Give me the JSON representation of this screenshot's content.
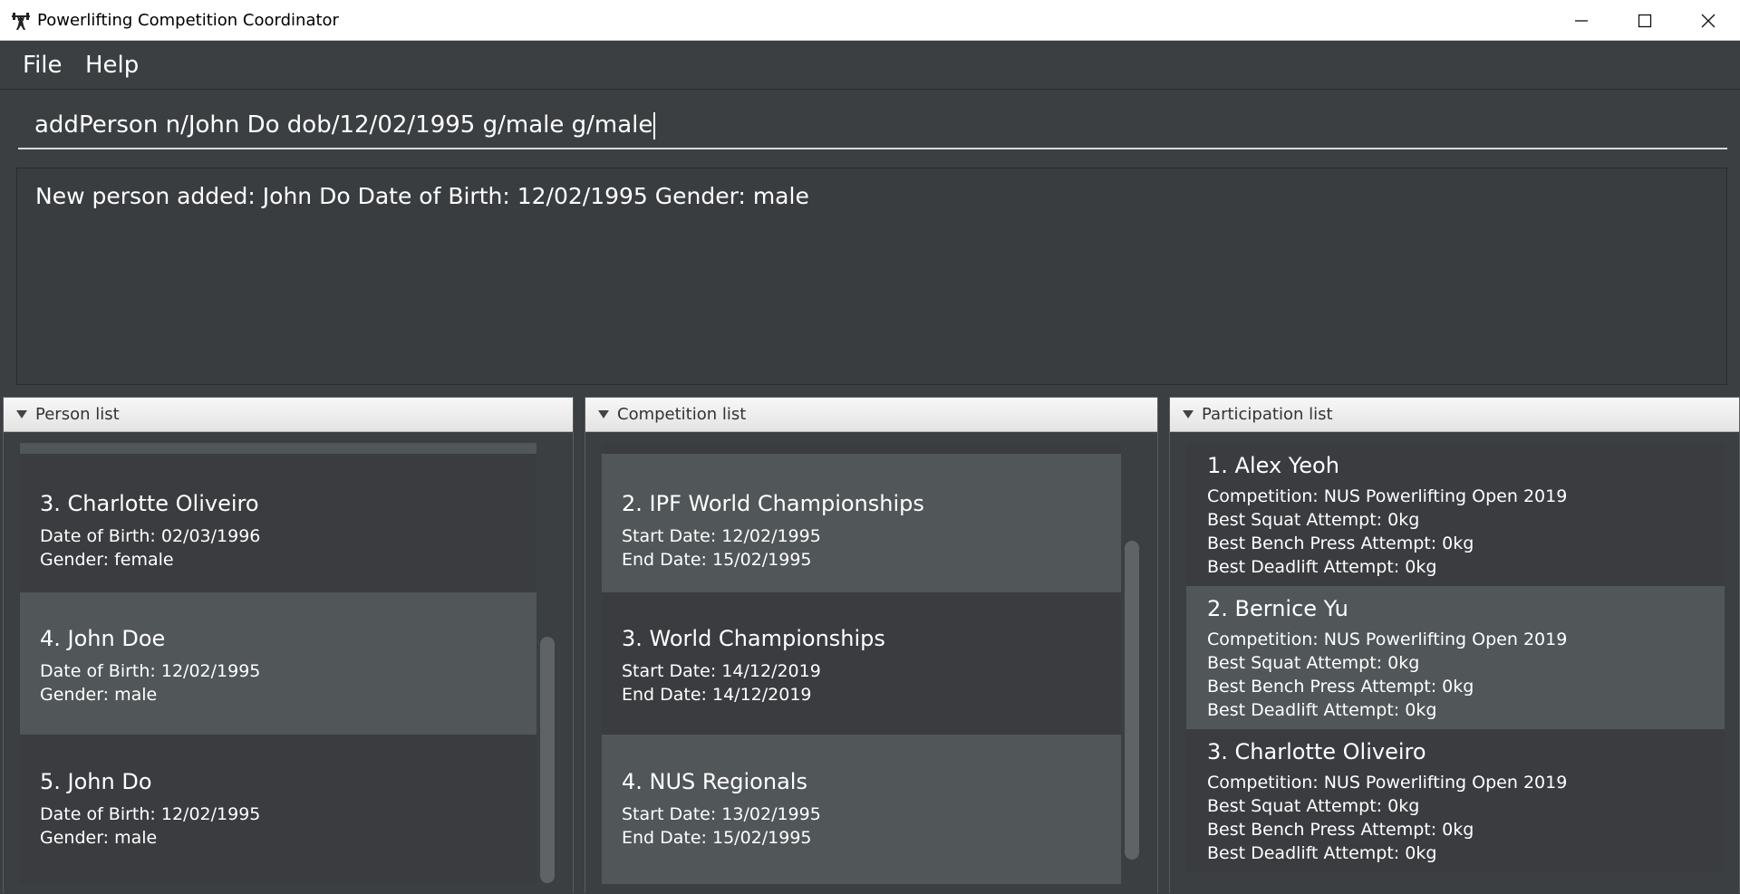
{
  "window": {
    "title": "Powerlifting Competition Coordinator"
  },
  "menu": {
    "file": "File",
    "help": "Help"
  },
  "command": {
    "value": "addPerson n/John Do dob/12/02/1995 g/male g/male"
  },
  "result": {
    "text": "New person added: John Do Date of Birth: 12/02/1995 Gender: male"
  },
  "person_panel": {
    "title": "Person list",
    "items": [
      {
        "name": "3.  Charlotte Oliveiro",
        "dob": "Date of Birth: 02/03/1996",
        "gender": "Gender: female"
      },
      {
        "name": "4.  John Doe",
        "dob": "Date of Birth: 12/02/1995",
        "gender": "Gender: male"
      },
      {
        "name": "5.  John Do",
        "dob": "Date of Birth: 12/02/1995",
        "gender": "Gender: male"
      }
    ]
  },
  "competition_panel": {
    "title": "Competition list",
    "items": [
      {
        "name": "2.  IPF World Championships",
        "start": "Start Date: 12/02/1995",
        "end": "End Date: 15/02/1995"
      },
      {
        "name": "3.  World Championships",
        "start": "Start Date: 14/12/2019",
        "end": "End Date: 14/12/2019"
      },
      {
        "name": "4.  NUS Regionals",
        "start": "Start Date: 13/02/1995",
        "end": "End Date: 15/02/1995"
      }
    ]
  },
  "participation_panel": {
    "title": "Participation list",
    "items": [
      {
        "name": "1.  Alex Yeoh",
        "competition": "Competition: NUS Powerlifting Open 2019",
        "squat": "Best Squat Attempt: 0kg",
        "bench": "Best Bench Press Attempt: 0kg",
        "deadlift": "Best Deadlift Attempt: 0kg"
      },
      {
        "name": "2.  Bernice Yu",
        "competition": "Competition: NUS Powerlifting Open 2019",
        "squat": "Best Squat Attempt: 0kg",
        "bench": "Best Bench Press Attempt: 0kg",
        "deadlift": "Best Deadlift Attempt: 0kg"
      },
      {
        "name": "3.  Charlotte Oliveiro",
        "competition": "Competition: NUS Powerlifting Open 2019",
        "squat": "Best Squat Attempt: 0kg",
        "bench": "Best Bench Press Attempt: 0kg",
        "deadlift": "Best Deadlift Attempt: 0kg"
      }
    ]
  },
  "icons": {
    "app": "weightlifter-icon",
    "minimize": "minimize-icon",
    "maximize": "maximize-icon",
    "close": "close-icon",
    "collapse": "triangle-down-icon"
  },
  "colors": {
    "background": "#3c3f41",
    "card_dark": "#3a3c3f",
    "card_selected": "#515658",
    "text": "#ffffff"
  }
}
